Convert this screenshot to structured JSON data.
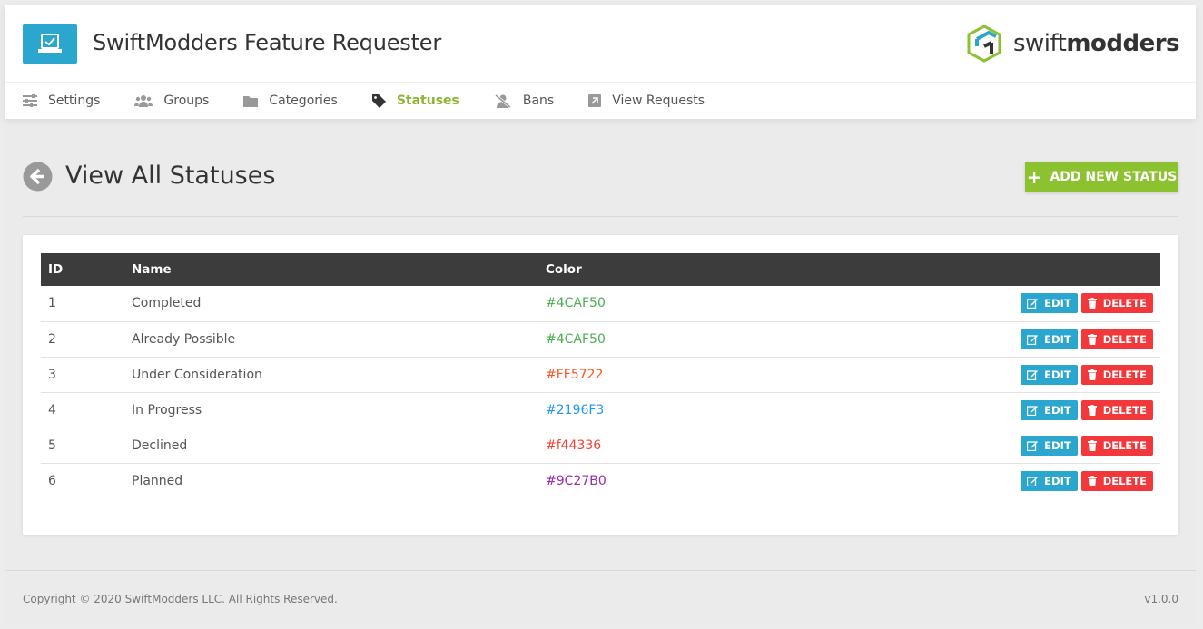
{
  "header": {
    "app_title": "SwiftModders Feature Requester",
    "brand_light": "swift",
    "brand_bold": "modders"
  },
  "nav": {
    "items": [
      {
        "label": "Settings",
        "icon": "sliders-icon"
      },
      {
        "label": "Groups",
        "icon": "users-icon"
      },
      {
        "label": "Categories",
        "icon": "folder-icon"
      },
      {
        "label": "Statuses",
        "icon": "tag-icon",
        "active": true
      },
      {
        "label": "Bans",
        "icon": "user-slash-icon"
      },
      {
        "label": "View Requests",
        "icon": "external-link-icon"
      }
    ]
  },
  "page": {
    "title": "View All Statuses",
    "add_button_label": "ADD NEW STATUS"
  },
  "table": {
    "headers": [
      "ID",
      "Name",
      "Color"
    ],
    "edit_label": "EDIT",
    "delete_label": "DELETE",
    "rows": [
      {
        "id": "1",
        "name": "Completed",
        "color": "#4CAF50"
      },
      {
        "id": "2",
        "name": "Already Possible",
        "color": "#4CAF50"
      },
      {
        "id": "3",
        "name": "Under Consideration",
        "color": "#FF5722"
      },
      {
        "id": "4",
        "name": "In Progress",
        "color": "#2196F3"
      },
      {
        "id": "5",
        "name": "Declined",
        "color": "#f44336"
      },
      {
        "id": "6",
        "name": "Planned",
        "color": "#9C27B0"
      }
    ]
  },
  "footer": {
    "copyright": "Copyright © 2020 SwiftModders LLC. All Rights Reserved.",
    "version": "v1.0.0"
  },
  "colors": {
    "accent_blue": "#2aa6cf",
    "accent_green": "#8cc12f",
    "danger": "#f2383a",
    "table_header": "#3c3c3c"
  }
}
